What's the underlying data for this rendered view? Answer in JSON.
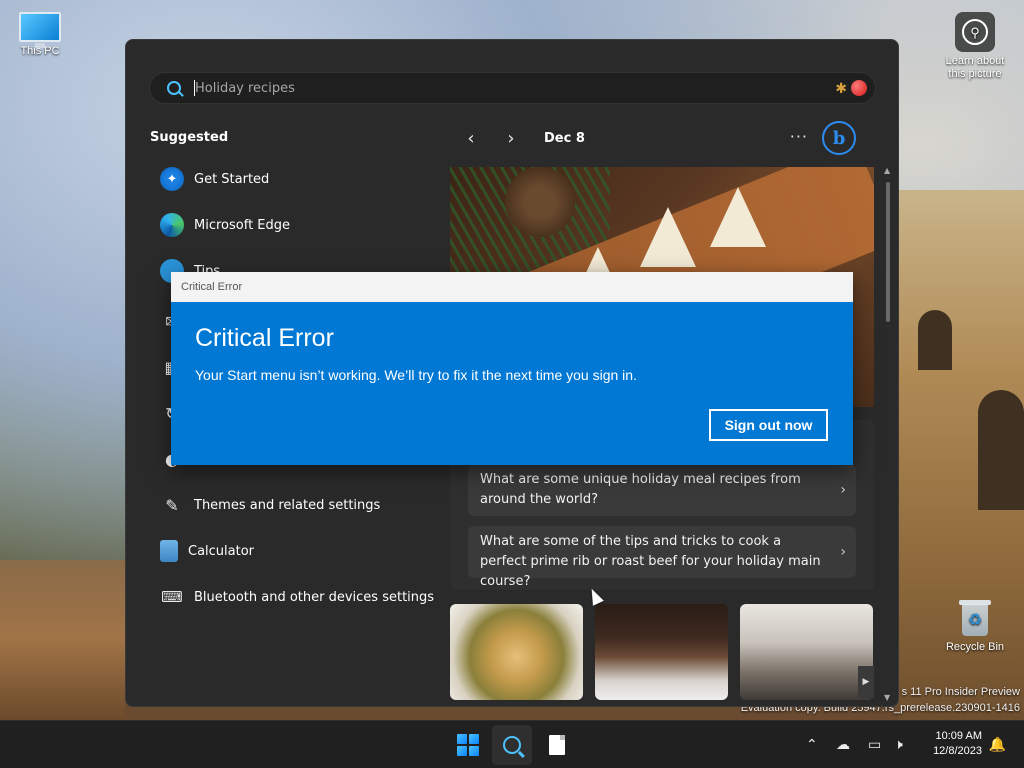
{
  "desktop": {
    "icons": [
      {
        "label": "This PC"
      },
      {
        "label": "Learn about this picture"
      },
      {
        "label": "Recycle Bin"
      }
    ],
    "watermark": {
      "line1": "s 11 Pro Insider Preview",
      "line2": "Evaluation copy. Build 25947.rs_prerelease.230901-1416"
    }
  },
  "start_menu": {
    "search": {
      "placeholder": "Holiday recipes"
    },
    "suggested_title": "Suggested",
    "suggested": [
      {
        "label": "Get Started",
        "icon": "get-started-icon"
      },
      {
        "label": "Microsoft Edge",
        "icon": "edge-icon"
      },
      {
        "label": "Tips",
        "icon": "tips-icon"
      },
      {
        "label": "Themes and related settings",
        "icon": "brush-icon"
      },
      {
        "label": "Calculator",
        "icon": "calculator-icon"
      },
      {
        "label": "Bluetooth and other devices settings",
        "icon": "bluetooth-devices-icon"
      }
    ],
    "feed": {
      "date": "Dec 8",
      "more_label": "···",
      "bing_label": "b",
      "questions": [
        "What are some unique holiday meal recipes from around the world?",
        "What are some of the tips and tricks to cook a perfect prime rib or roast beef for your holiday main course?"
      ]
    }
  },
  "dialog": {
    "titlebar": "Critical Error",
    "heading": "Critical Error",
    "message": "Your Start menu isn’t working. We’ll try to fix it the next time you sign in.",
    "button": "Sign out now"
  },
  "taskbar": {
    "clock_time": "10:09 AM",
    "clock_date": "12/8/2023"
  },
  "colors": {
    "accent": "#0078d4",
    "start_bg": "#2a2a2a",
    "taskbar_bg": "#202020"
  }
}
